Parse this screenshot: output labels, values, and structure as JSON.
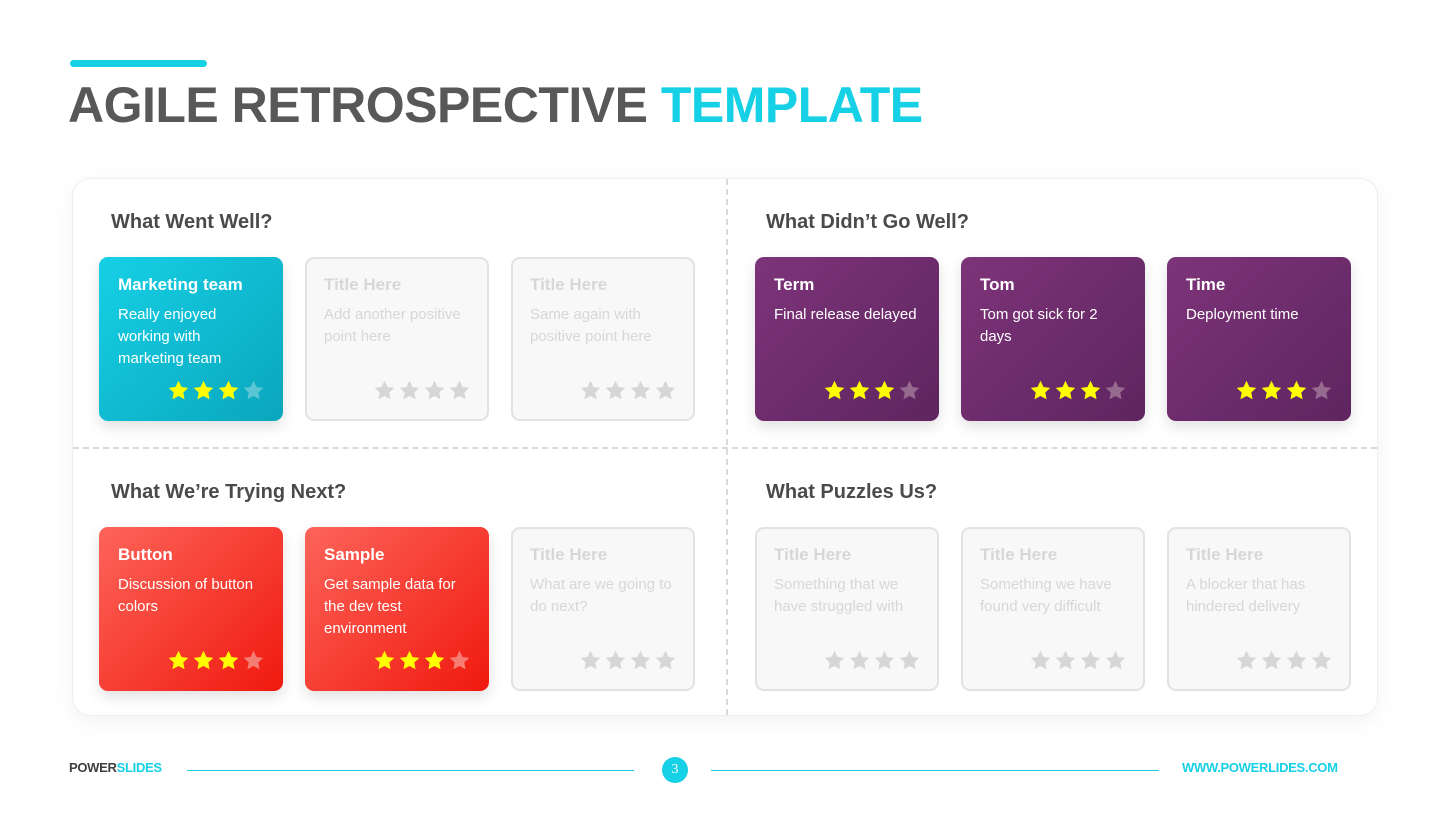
{
  "header": {
    "title_main": "AGILE RETROSPECTIVE",
    "title_highlight": "TEMPLATE"
  },
  "colors": {
    "accent": "#16d0e6",
    "teal_card": "#16d0e6",
    "purple_card": "#7d3479",
    "red_card": "#fd645a",
    "star_filled": "#ffff00"
  },
  "quadrants": [
    {
      "title": "What Went Well?",
      "cards": [
        {
          "style": "teal",
          "title": "Marketing team",
          "text": "Really enjoyed working with marketing team",
          "rating": 3,
          "max_rating": 4
        },
        {
          "style": "blank",
          "title": "Title Here",
          "text": "Add another positive point here",
          "rating": 0,
          "max_rating": 4
        },
        {
          "style": "blank",
          "title": "Title Here",
          "text": "Same again with positive point here",
          "rating": 0,
          "max_rating": 4
        }
      ]
    },
    {
      "title": "What Didn’t Go Well?",
      "cards": [
        {
          "style": "purple",
          "title": "Term",
          "text": "Final release delayed",
          "rating": 3,
          "max_rating": 4
        },
        {
          "style": "purple",
          "title": "Tom",
          "text": "Tom got sick for 2 days",
          "rating": 3,
          "max_rating": 4
        },
        {
          "style": "purple",
          "title": "Time",
          "text": "Deployment time",
          "rating": 3,
          "max_rating": 4
        }
      ]
    },
    {
      "title": "What We’re Trying Next?",
      "cards": [
        {
          "style": "red",
          "title": "Button",
          "text": "Discussion of button colors",
          "rating": 3,
          "max_rating": 4
        },
        {
          "style": "red",
          "title": "Sample",
          "text": "Get sample data for the dev test environment",
          "rating": 3,
          "max_rating": 4
        },
        {
          "style": "blank",
          "title": "Title Here",
          "text": "What are we going to do next?",
          "rating": 0,
          "max_rating": 4
        }
      ]
    },
    {
      "title": "What Puzzles Us?",
      "cards": [
        {
          "style": "blank",
          "title": "Title Here",
          "text": "Something that we have struggled with",
          "rating": 0,
          "max_rating": 4
        },
        {
          "style": "blank",
          "title": "Title Here",
          "text": "Something we have found very difficult",
          "rating": 0,
          "max_rating": 4
        },
        {
          "style": "blank",
          "title": "Title Here",
          "text": "A blocker that has hindered delivery",
          "rating": 0,
          "max_rating": 4
        }
      ]
    }
  ],
  "footer": {
    "brand_main": "POWER",
    "brand_highlight": "SLIDES",
    "page_number": "3",
    "url": "WWW.POWERLIDES.COM"
  },
  "icons": {
    "star": "star-icon"
  }
}
